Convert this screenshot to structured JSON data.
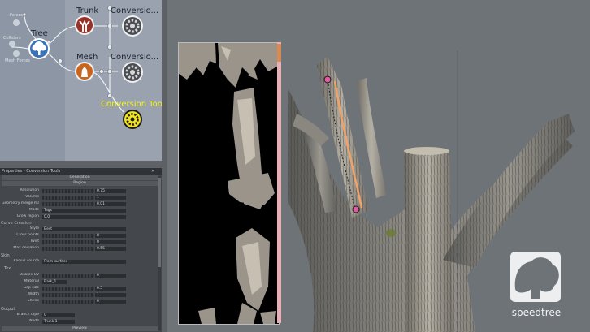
{
  "graph": {
    "tree_label": "Tree",
    "trunk_label": "Trunk",
    "mesh_label": "Mesh",
    "conversion_label_1": "Conversio...",
    "conversion_label_2": "Conversio...",
    "conversion_tool_label": "Conversion Tool",
    "side_labels": [
      "Forces",
      "Colliders",
      "Mesh Forces"
    ]
  },
  "properties": {
    "title": "Properties - Conversion Tools",
    "sections": [
      "Generation",
      "Region"
    ],
    "rows_a": [
      {
        "label": "Resolution",
        "value": "0.75"
      },
      {
        "label": "Volume",
        "value": "1"
      },
      {
        "label": "Geometry merge margin",
        "value": "0.01"
      },
      {
        "label": "Mode",
        "value": "Tags"
      },
      {
        "label": "Grow region",
        "value": "0.0"
      }
    ],
    "group_b": "Curve Creation",
    "rows_b": [
      {
        "label": "Style",
        "value": "Best"
      },
      {
        "label": "Cross points",
        "value": "8"
      },
      {
        "label": "Twist",
        "value": "0"
      },
      {
        "label": "Max deviation",
        "value": "0.55"
      }
    ],
    "group_c": "Skin",
    "rows_c": [
      {
        "label": "Radius source",
        "value": "From surface"
      }
    ],
    "group_d": "Tex",
    "rows_d": [
      {
        "label": "Disable UV",
        "value": "0"
      },
      {
        "label": "Material",
        "value": "Bark_1"
      },
      {
        "label": "Gap size",
        "value": "0.5"
      },
      {
        "label": "Width",
        "value": "1"
      },
      {
        "label": "Shrink",
        "value": "0"
      }
    ],
    "group_e": "Output",
    "rows_e": [
      {
        "label": "Branch type",
        "value": "0"
      },
      {
        "label": "Node",
        "value": "Trunk 1"
      }
    ],
    "footer_section": "Preview"
  },
  "brand": {
    "name": "speedtree"
  },
  "colors": {
    "graph_bg": "#8d96a4",
    "selected_label": "#f2f21a",
    "panel_bg": "#44484d"
  }
}
